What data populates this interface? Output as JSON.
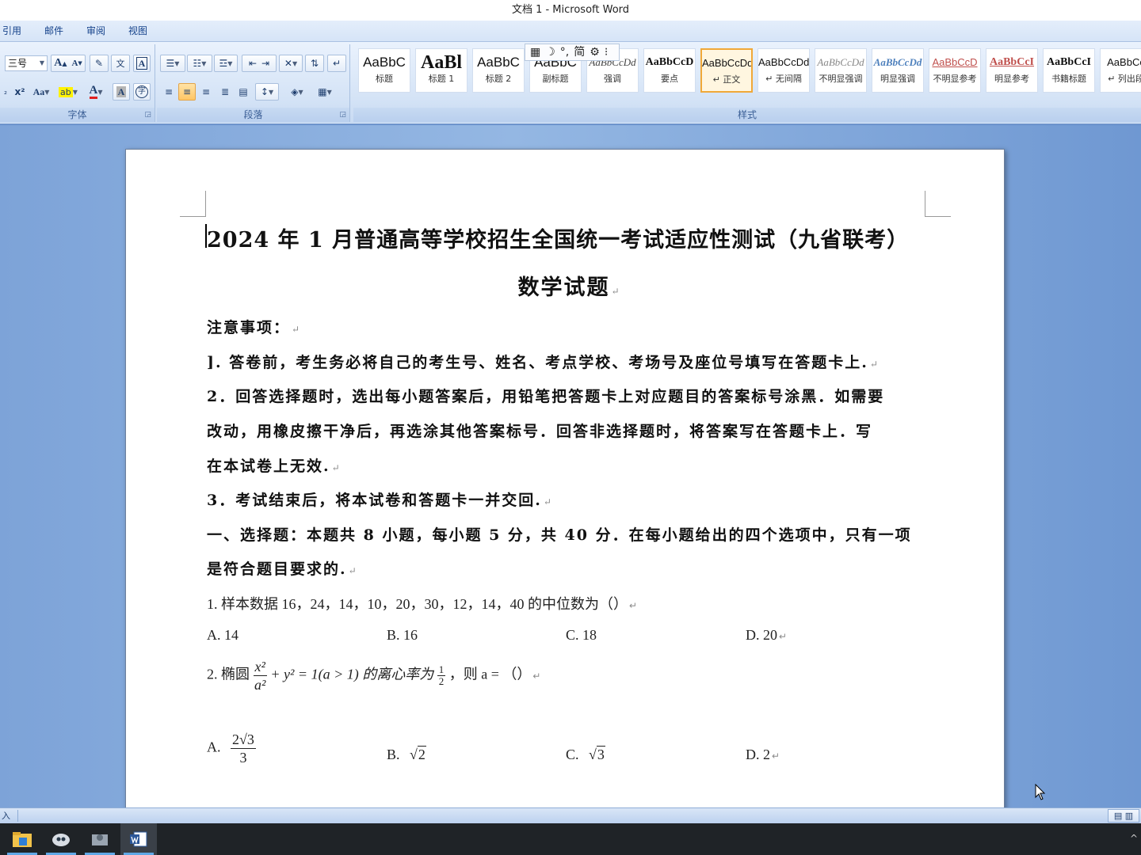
{
  "window": {
    "title": "文档 1 - Microsoft Word"
  },
  "ribbon_tabs": [
    "引用",
    "邮件",
    "审阅",
    "视图"
  ],
  "font_group": {
    "label": "字体",
    "font_size": "三号",
    "grow_label": "A",
    "shrink_label": "A",
    "case_label": "Aa",
    "font_color_label": "A",
    "char_shading_label": "A",
    "enclose_label": "字"
  },
  "paragraph_group": {
    "label": "段落"
  },
  "styles_group": {
    "label": "样式",
    "items": [
      {
        "sample": "AaBbC",
        "name": "标题"
      },
      {
        "sample": "AaBl",
        "name": "标题 1"
      },
      {
        "sample": "AaBbC",
        "name": "标题 2"
      },
      {
        "sample": "AaBbC",
        "name": "副标题"
      },
      {
        "sample": "AaBbCcDd",
        "name": "强调"
      },
      {
        "sample": "AaBbCcD",
        "name": "要点"
      },
      {
        "sample": "AaBbCcDd",
        "name": "↵ 正文"
      },
      {
        "sample": "AaBbCcDd",
        "name": "↵ 无间隔"
      },
      {
        "sample": "AaBbCcDd",
        "name": "不明显强调"
      },
      {
        "sample": "AaBbCcDd",
        "name": "明显强调"
      },
      {
        "sample": "AaBbCcD",
        "name": "不明显参考"
      },
      {
        "sample": "AaBbCcI",
        "name": "明显参考"
      },
      {
        "sample": "AaBbCcI",
        "name": "书籍标题"
      },
      {
        "sample": "AaBbCc",
        "name": "↵ 列出段"
      }
    ],
    "selected_index": 6
  },
  "minibar": {
    "label": "简"
  },
  "document": {
    "title_line1": "2024 年 1 月普通高等学校招生全国统一考试适应性测试（九省联考）",
    "title_line2": "数学试题",
    "notice_heading": "注意事项：",
    "notice_1": "].  答卷前，考生务必将自己的考生号、姓名、考点学校、考场号及座位号填写在答题卡上.",
    "notice_2a": "2．回答选择题时，选出每小题答案后，用铅笔把答题卡上对应题目的答案标号涂黑．如需要",
    "notice_2b": "改动，用橡皮擦干净后，再选涂其他答案标号．回答非选择题时，将答案写在答题卡上．写",
    "notice_2c": "在本试卷上无效.",
    "notice_3": "3．考试结束后，将本试卷和答题卡一并交回.",
    "section_1a": "一、选择题：本题共 8 小题，每小题 5 分，共 40 分．在每小题给出的四个选项中，只有一项",
    "section_1b": "是符合题目要求的.",
    "q1_text": "1. 样本数据 16，24，14，10，20，30，12，14，40 的中位数为（）",
    "q1_options": [
      "A. 14",
      "B. 16",
      "C. 18",
      "D. 20"
    ],
    "q2_prefix": "2. 椭圆",
    "q2_frac_num": "x²",
    "q2_frac_den": "a²",
    "q2_mid": "+ y² = 1(a > 1) 的离心率为",
    "q2_half_num": "1",
    "q2_half_den": "2",
    "q2_suffix": "，则 a = （）",
    "q2_option_a_label": "A.",
    "q2_option_a_num": "2√3",
    "q2_option_a_den": "3",
    "q2_option_b_label": "B.",
    "q2_option_b_value": "2",
    "q2_option_c_label": "C.",
    "q2_option_c_value": "3",
    "q2_option_d": "D. 2",
    "paragraph_mark": "↵"
  },
  "statusbar": {
    "left_text": "入"
  }
}
